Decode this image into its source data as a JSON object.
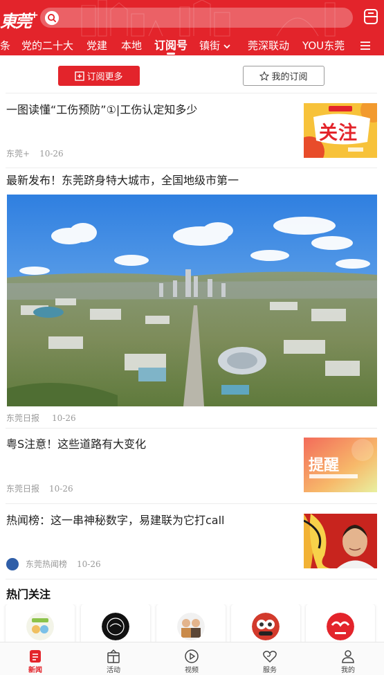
{
  "header": {
    "logo_text": "東莞",
    "logo_plus": "+",
    "search_placeholder": "",
    "channels": [
      "条",
      "党的二十大",
      "党建",
      "本地",
      "订阅号",
      "镇街",
      "莞深联动",
      "YOU东莞"
    ],
    "active_channel": "订阅号"
  },
  "subscribe": {
    "more_label": "订阅更多",
    "mine_label": "我的订阅"
  },
  "news": [
    {
      "title": "一图读懂“工伤预防”①|工伤认定知多少",
      "source": "东莞+",
      "time": "10-26",
      "thumb_text": "关注"
    },
    {
      "title": "最新发布！东莞跻身特大城市，全国地级市第一",
      "source": "东莞日报",
      "time": "10-26"
    },
    {
      "title": "粤S注意！这些道路有大变化",
      "source": "东莞日报",
      "time": "10-26",
      "thumb_text": "提醒"
    },
    {
      "title": "热闻榜：这一串神秘数字，易建联为它打call",
      "source": "东莞热闻榜",
      "time": "10-26"
    }
  ],
  "hot_follow": {
    "title": "热门关注"
  },
  "tabbar": [
    {
      "label": "新闻",
      "icon": "news-icon",
      "active": true
    },
    {
      "label": "活动",
      "icon": "activity-icon",
      "active": false
    },
    {
      "label": "视频",
      "icon": "video-play-icon",
      "active": false
    },
    {
      "label": "服务",
      "icon": "heart-service-icon",
      "active": false
    },
    {
      "label": "我的",
      "icon": "user-icon",
      "active": false
    }
  ],
  "colors": {
    "brand_red": "#e3242b",
    "text": "#222222",
    "meta": "#999999"
  }
}
